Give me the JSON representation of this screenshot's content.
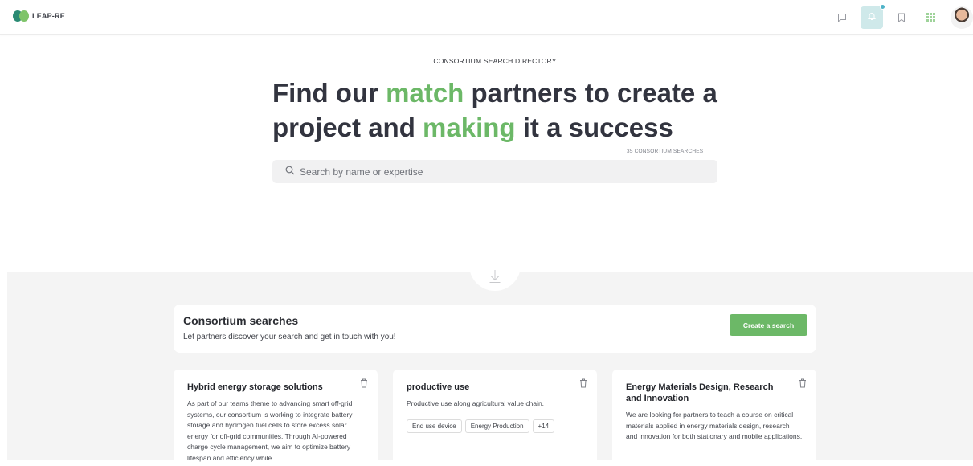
{
  "header": {
    "logo_text": "LEAP-RE",
    "icons": [
      "chat-icon",
      "bell-icon",
      "bookmark-icon",
      "grid-icon"
    ],
    "accent": "#cfe9ea",
    "notification_color": "#4fb3c8"
  },
  "hero": {
    "eyebrow": "CONSORTIUM SEARCH DIRECTORY",
    "line1_a": "Find our ",
    "line1_b": "match",
    "line1_c": " partners to create a",
    "line2_a": "project and ",
    "line2_b": "making",
    "line2_c": " it a success",
    "highlight_color": "#6cb867",
    "count": "35 CONSORTIUM SEARCHES",
    "search_placeholder": "Search by name or expertise"
  },
  "consortium": {
    "title": "Consortium searches",
    "subtitle": "Let partners discover your search and get in touch with you!",
    "create_label": "Create a search",
    "button_color": "#6cb867"
  },
  "cards": [
    {
      "title": "Hybrid energy storage solutions",
      "description": "As part of our teams theme to advancing smart off-grid systems, our consortium is working to integrate battery storage and hydrogen fuel cells to store excess solar energy for off-grid communities. Through AI-powered charge cycle management, we aim to optimize battery lifespan and efficiency while",
      "tags": []
    },
    {
      "title": "productive use",
      "description": "Productive use along agricultural value chain.",
      "tags": [
        "End use device",
        "Energy Production",
        "+14"
      ]
    },
    {
      "title": "Energy Materials Design, Research and Innovation",
      "description": "We are looking for partners to teach a course on critical materials applied in energy materials design, research and innovation for both stationary and mobile applications.",
      "tags": []
    }
  ]
}
